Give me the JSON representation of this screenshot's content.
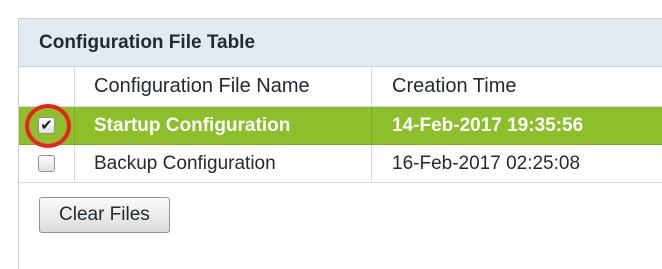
{
  "table": {
    "title": "Configuration File Table",
    "columns": {
      "name": "Configuration File Name",
      "time": "Creation Time"
    },
    "rows": [
      {
        "checked": true,
        "checkmark": "✔",
        "name": "Startup Configuration",
        "time": "14-Feb-2017 19:35:56",
        "selected": true
      },
      {
        "checked": false,
        "checkmark": "",
        "name": "Backup Configuration",
        "time": "16-Feb-2017 02:25:08",
        "selected": false
      }
    ]
  },
  "actions": {
    "clear_files_label": "Clear Files"
  },
  "colors": {
    "selected_row": "#8cbf2a",
    "highlight_ring": "#e8231f",
    "title_bar": "#e3ebf2"
  },
  "icons": {
    "checkbox_checked": "check-icon"
  }
}
